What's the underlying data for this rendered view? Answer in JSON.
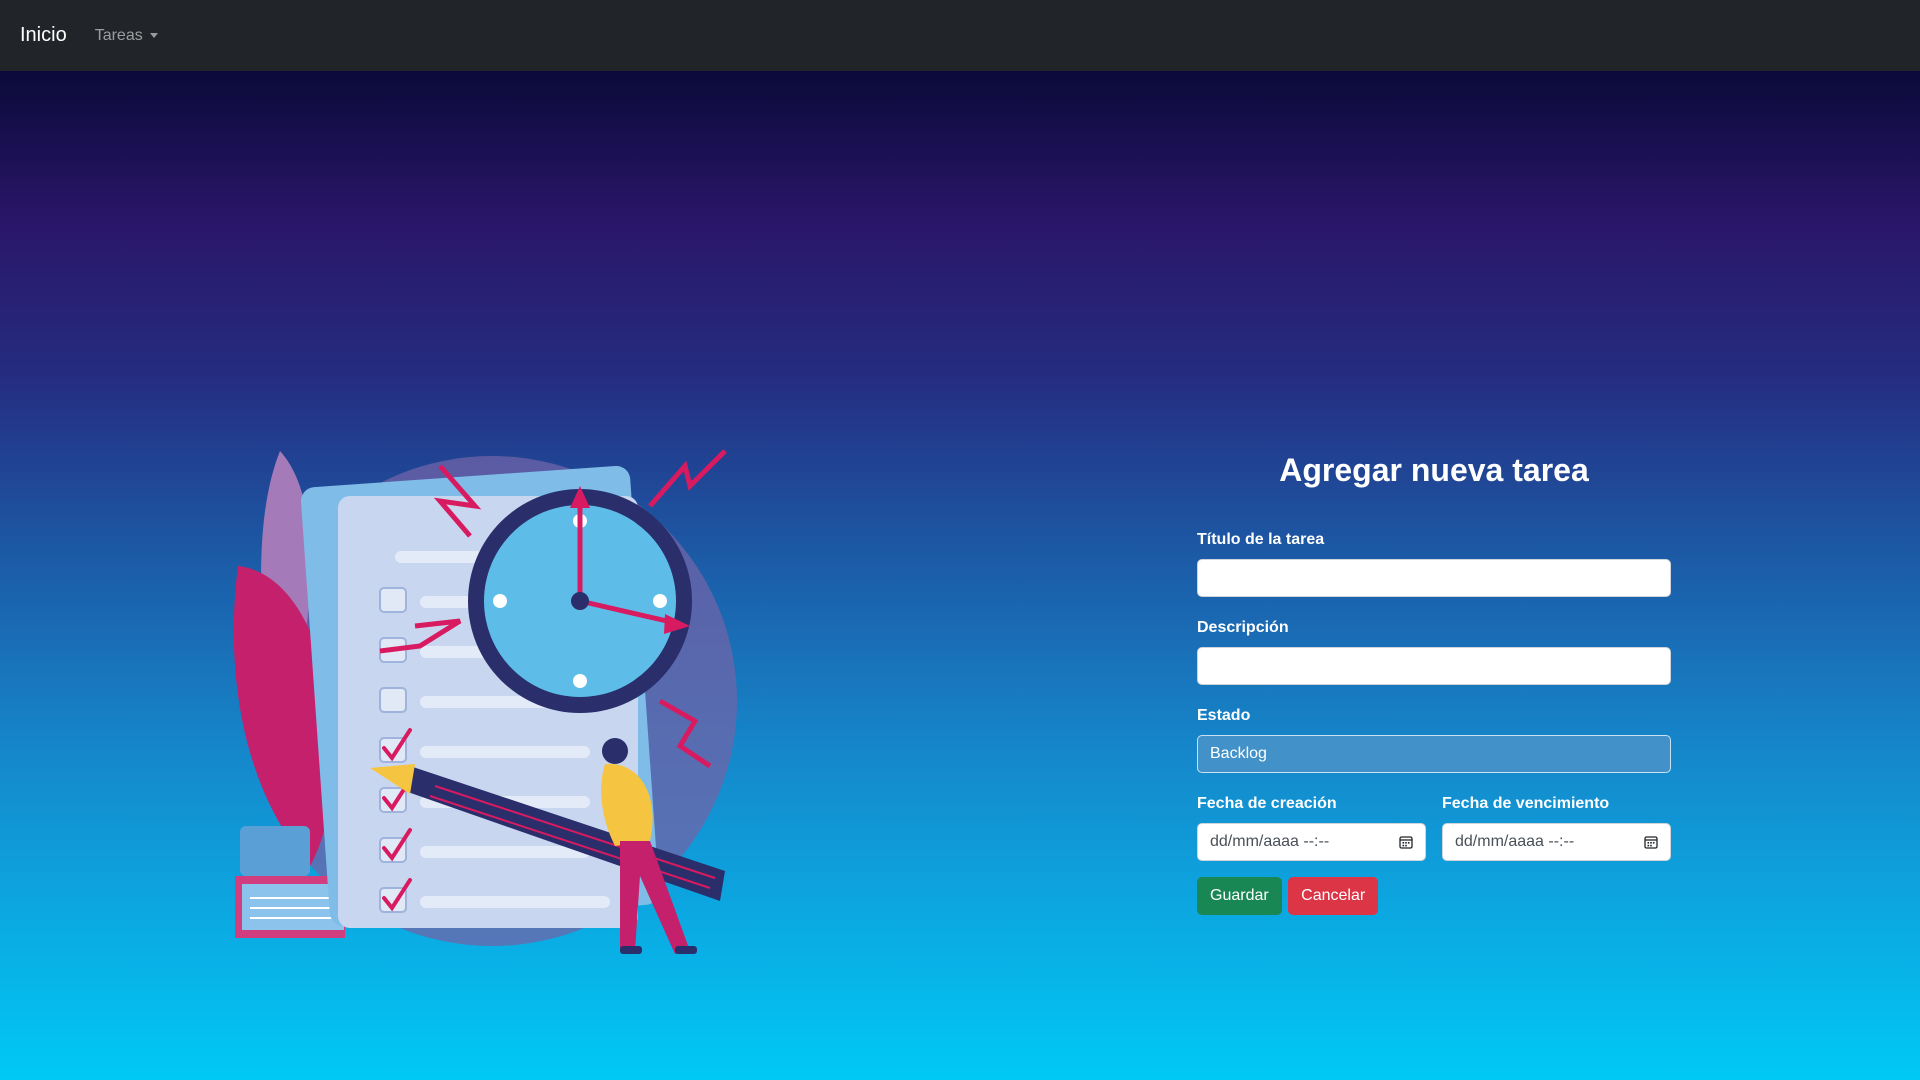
{
  "navbar": {
    "brand": "Inicio",
    "menu_label": "Tareas"
  },
  "form": {
    "title": "Agregar nueva tarea",
    "title_field": {
      "label": "Título de la tarea",
      "value": ""
    },
    "description_field": {
      "label": "Descripción",
      "value": ""
    },
    "status_field": {
      "label": "Estado",
      "selected": "Backlog"
    },
    "created_date": {
      "label": "Fecha de creación",
      "placeholder": "dd/mm/aaaa --:--"
    },
    "due_date": {
      "label": "Fecha de vencimiento",
      "placeholder": "dd/mm/aaaa --:--"
    },
    "save_button": "Guardar",
    "cancel_button": "Cancelar"
  },
  "colors": {
    "navbar": "#212529",
    "success": "#198754",
    "danger": "#dc3545",
    "select_background": "#4292c9"
  },
  "icons": {
    "calendar": "calendar-icon",
    "caret": "caret-down-icon",
    "illustration": "task-checklist-clock-illustration"
  }
}
